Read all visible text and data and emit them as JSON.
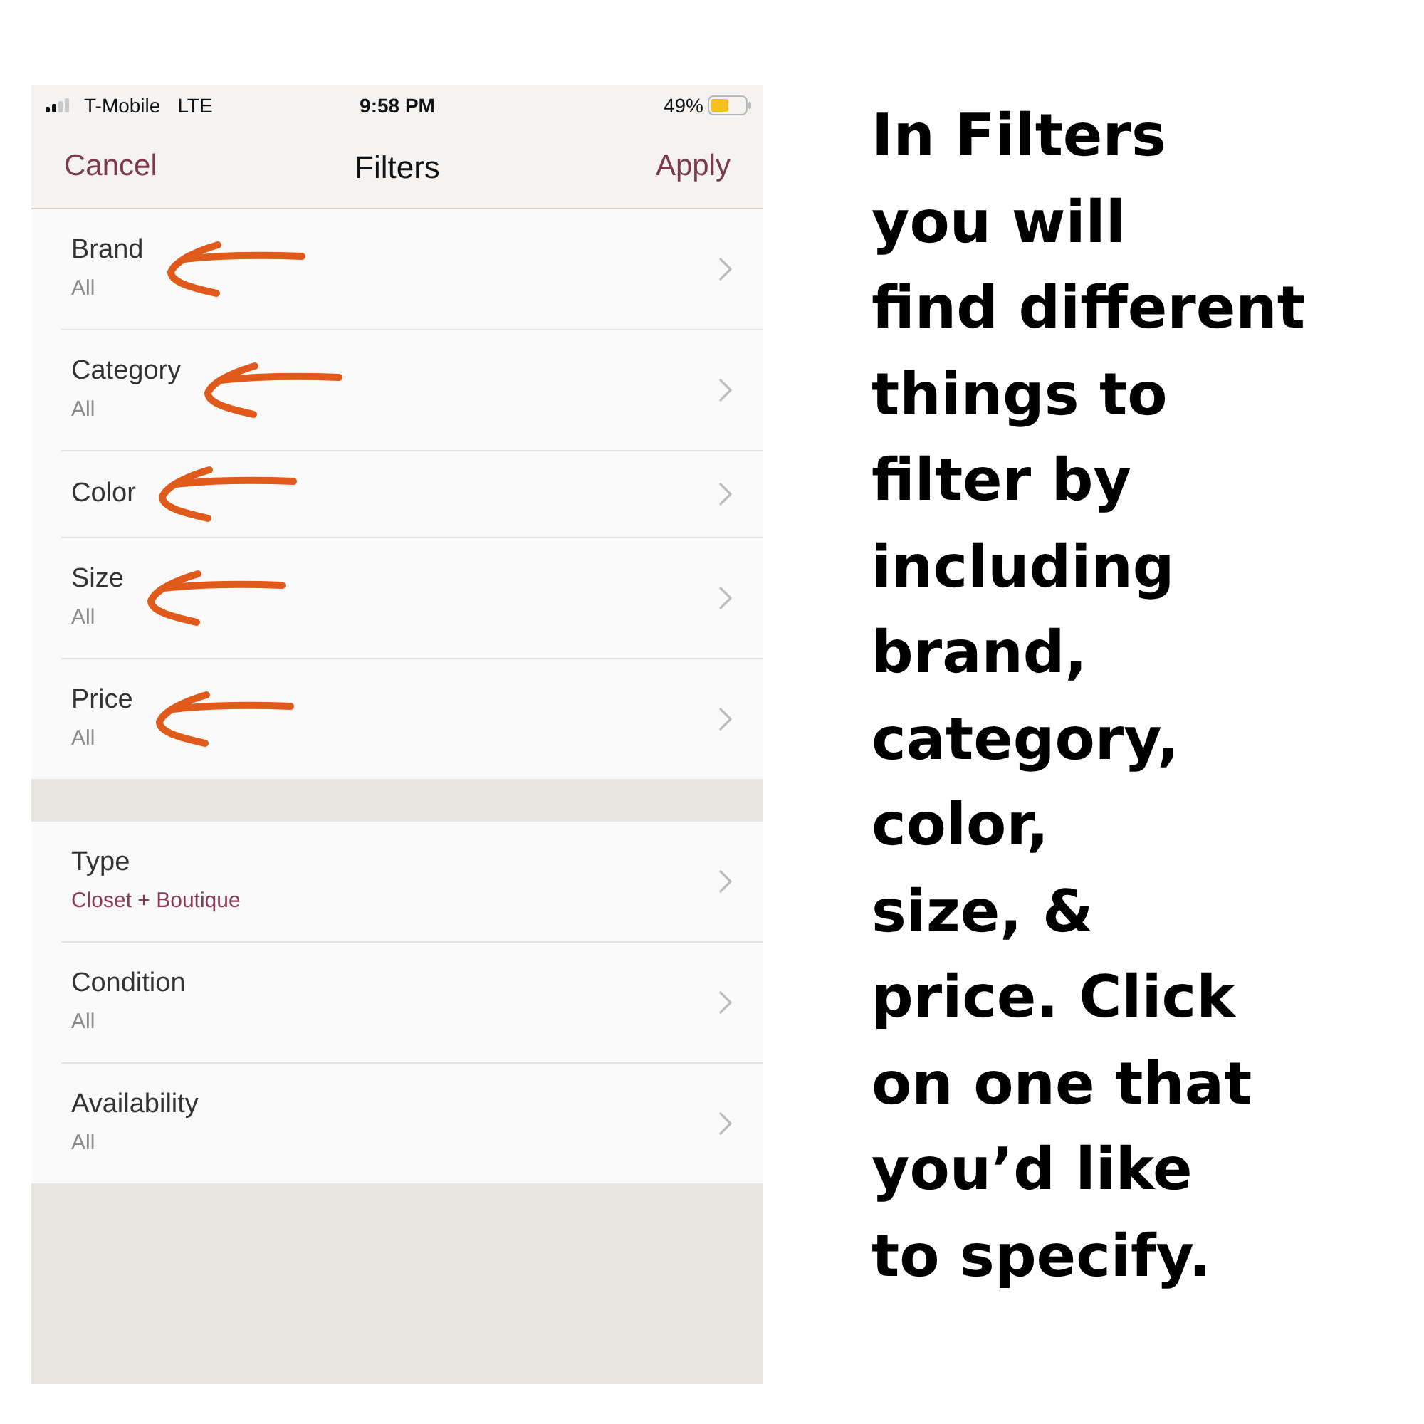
{
  "status_bar": {
    "carrier": "T-Mobile",
    "network": "LTE",
    "time": "9:58 PM",
    "battery": "49%"
  },
  "nav_bar": {
    "cancel": "Cancel",
    "title": "Filters",
    "apply": "Apply"
  },
  "sections": [
    {
      "rows": [
        {
          "title": "Brand",
          "value": "All",
          "highlighted": false,
          "annotated": true
        },
        {
          "title": "Category",
          "value": "All",
          "highlighted": false,
          "annotated": true
        },
        {
          "title": "Color",
          "annotated": true
        },
        {
          "title": "Size",
          "value": "All",
          "highlighted": false,
          "annotated": true
        },
        {
          "title": "Price",
          "value": "All",
          "highlighted": false,
          "annotated": true
        }
      ]
    },
    {
      "rows": [
        {
          "title": "Type",
          "value": "Closet + Boutique",
          "highlighted": true,
          "annotated": false
        },
        {
          "title": "Condition",
          "value": "All",
          "highlighted": false,
          "annotated": false
        },
        {
          "title": "Availability",
          "value": "All",
          "highlighted": false,
          "annotated": false
        }
      ]
    }
  ],
  "caption": "In Filters\nyou will\nfind different\nthings to\nfilter by\nincluding\nbrand,\ncategory,\ncolor,\nsize, &\nprice. Click\non one that\nyou’d like\nto specify."
}
